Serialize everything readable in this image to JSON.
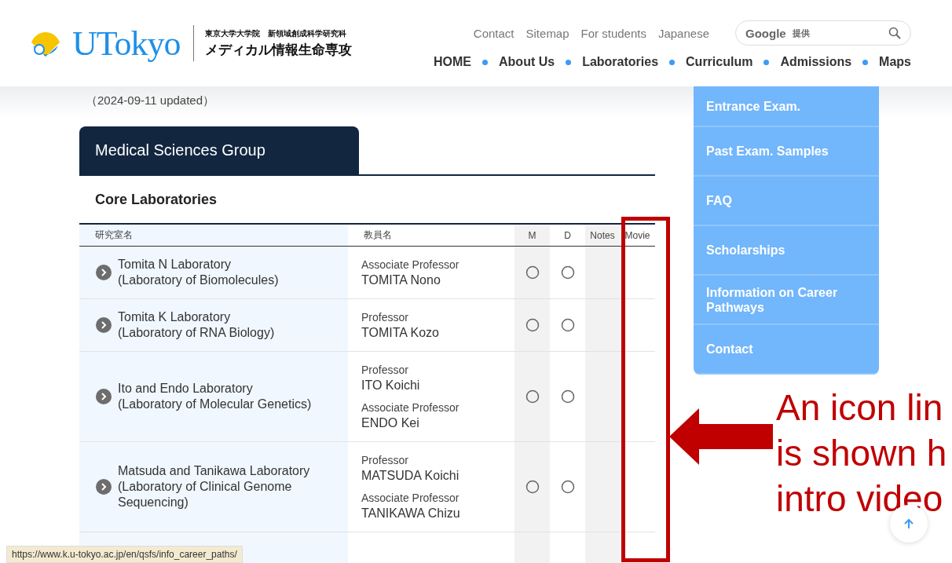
{
  "header": {
    "logo_text": "UTokyo",
    "subtitle": "東京大学大学院　新領域創成科学研究科",
    "title": "メディカル情報生命専攻"
  },
  "top_links": [
    "Contact",
    "Sitemap",
    "For students",
    "Japanese"
  ],
  "search": {
    "placeholder": "提供",
    "brand": "Google"
  },
  "nav": [
    "HOME",
    "About Us",
    "Laboratories",
    "Curriculum",
    "Admissions",
    "Maps"
  ],
  "dropdown": [
    "Entrance Exam.",
    "Past Exam. Samples",
    "FAQ",
    "Scholarships",
    "Information on Career Pathways",
    "Contact"
  ],
  "updated": "（2024-09-11 updated）",
  "group_tab": "Medical Sciences Group",
  "section_title": "Core Laboratories",
  "table": {
    "columns": [
      "研究室名",
      "教員名",
      "M",
      "D",
      "Notes",
      "Movie"
    ],
    "rows": [
      {
        "lab": "Tomita N Laboratory",
        "lab_sub": "(Laboratory of Biomolecules)",
        "staff": [
          {
            "title": "Associate Professor",
            "name": "TOMITA Nono"
          }
        ],
        "m": true,
        "d": true
      },
      {
        "lab": "Tomita K Laboratory",
        "lab_sub": "(Laboratory of RNA Biology)",
        "staff": [
          {
            "title": "Professor",
            "name": "TOMITA Kozo"
          }
        ],
        "m": true,
        "d": true
      },
      {
        "lab": "Ito and Endo Laboratory",
        "lab_sub": "(Laboratory of Molecular Genetics)",
        "staff": [
          {
            "title": "Professor",
            "name": "ITO Koichi"
          },
          {
            "title": "Associate Professor",
            "name": "ENDO Kei"
          }
        ],
        "m": true,
        "d": true
      },
      {
        "lab": "Matsuda and Tanikawa Laboratory",
        "lab_sub": "(Laboratory of Clinical Genome Sequencing)",
        "staff": [
          {
            "title": "Professor",
            "name": "MATSUDA Koichi"
          },
          {
            "title": "Associate Professor",
            "name": "TANIKAWA Chizu"
          }
        ],
        "m": true,
        "d": true
      }
    ]
  },
  "annotation": [
    "An icon lin",
    "is shown h",
    "intro video"
  ],
  "status_url": "https://www.k.u-tokyo.ac.jp/en/qsfs/info_career_paths/"
}
